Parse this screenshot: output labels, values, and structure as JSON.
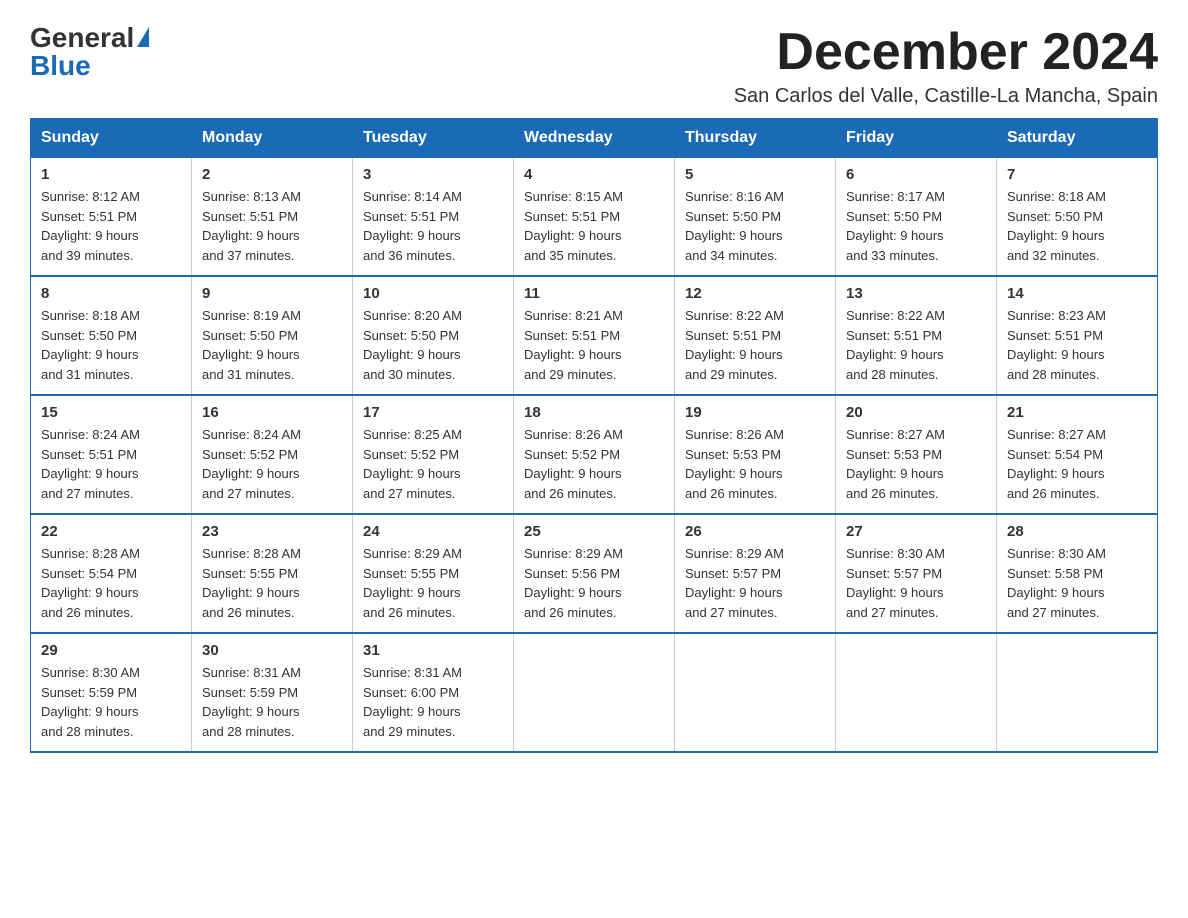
{
  "logo": {
    "general": "General",
    "blue": "Blue"
  },
  "header": {
    "month": "December 2024",
    "location": "San Carlos del Valle, Castille-La Mancha, Spain"
  },
  "weekdays": [
    "Sunday",
    "Monday",
    "Tuesday",
    "Wednesday",
    "Thursday",
    "Friday",
    "Saturday"
  ],
  "weeks": [
    [
      {
        "day": "1",
        "sunrise": "8:12 AM",
        "sunset": "5:51 PM",
        "daylight": "9 hours and 39 minutes."
      },
      {
        "day": "2",
        "sunrise": "8:13 AM",
        "sunset": "5:51 PM",
        "daylight": "9 hours and 37 minutes."
      },
      {
        "day": "3",
        "sunrise": "8:14 AM",
        "sunset": "5:51 PM",
        "daylight": "9 hours and 36 minutes."
      },
      {
        "day": "4",
        "sunrise": "8:15 AM",
        "sunset": "5:51 PM",
        "daylight": "9 hours and 35 minutes."
      },
      {
        "day": "5",
        "sunrise": "8:16 AM",
        "sunset": "5:50 PM",
        "daylight": "9 hours and 34 minutes."
      },
      {
        "day": "6",
        "sunrise": "8:17 AM",
        "sunset": "5:50 PM",
        "daylight": "9 hours and 33 minutes."
      },
      {
        "day": "7",
        "sunrise": "8:18 AM",
        "sunset": "5:50 PM",
        "daylight": "9 hours and 32 minutes."
      }
    ],
    [
      {
        "day": "8",
        "sunrise": "8:18 AM",
        "sunset": "5:50 PM",
        "daylight": "9 hours and 31 minutes."
      },
      {
        "day": "9",
        "sunrise": "8:19 AM",
        "sunset": "5:50 PM",
        "daylight": "9 hours and 31 minutes."
      },
      {
        "day": "10",
        "sunrise": "8:20 AM",
        "sunset": "5:50 PM",
        "daylight": "9 hours and 30 minutes."
      },
      {
        "day": "11",
        "sunrise": "8:21 AM",
        "sunset": "5:51 PM",
        "daylight": "9 hours and 29 minutes."
      },
      {
        "day": "12",
        "sunrise": "8:22 AM",
        "sunset": "5:51 PM",
        "daylight": "9 hours and 29 minutes."
      },
      {
        "day": "13",
        "sunrise": "8:22 AM",
        "sunset": "5:51 PM",
        "daylight": "9 hours and 28 minutes."
      },
      {
        "day": "14",
        "sunrise": "8:23 AM",
        "sunset": "5:51 PM",
        "daylight": "9 hours and 28 minutes."
      }
    ],
    [
      {
        "day": "15",
        "sunrise": "8:24 AM",
        "sunset": "5:51 PM",
        "daylight": "9 hours and 27 minutes."
      },
      {
        "day": "16",
        "sunrise": "8:24 AM",
        "sunset": "5:52 PM",
        "daylight": "9 hours and 27 minutes."
      },
      {
        "day": "17",
        "sunrise": "8:25 AM",
        "sunset": "5:52 PM",
        "daylight": "9 hours and 27 minutes."
      },
      {
        "day": "18",
        "sunrise": "8:26 AM",
        "sunset": "5:52 PM",
        "daylight": "9 hours and 26 minutes."
      },
      {
        "day": "19",
        "sunrise": "8:26 AM",
        "sunset": "5:53 PM",
        "daylight": "9 hours and 26 minutes."
      },
      {
        "day": "20",
        "sunrise": "8:27 AM",
        "sunset": "5:53 PM",
        "daylight": "9 hours and 26 minutes."
      },
      {
        "day": "21",
        "sunrise": "8:27 AM",
        "sunset": "5:54 PM",
        "daylight": "9 hours and 26 minutes."
      }
    ],
    [
      {
        "day": "22",
        "sunrise": "8:28 AM",
        "sunset": "5:54 PM",
        "daylight": "9 hours and 26 minutes."
      },
      {
        "day": "23",
        "sunrise": "8:28 AM",
        "sunset": "5:55 PM",
        "daylight": "9 hours and 26 minutes."
      },
      {
        "day": "24",
        "sunrise": "8:29 AM",
        "sunset": "5:55 PM",
        "daylight": "9 hours and 26 minutes."
      },
      {
        "day": "25",
        "sunrise": "8:29 AM",
        "sunset": "5:56 PM",
        "daylight": "9 hours and 26 minutes."
      },
      {
        "day": "26",
        "sunrise": "8:29 AM",
        "sunset": "5:57 PM",
        "daylight": "9 hours and 27 minutes."
      },
      {
        "day": "27",
        "sunrise": "8:30 AM",
        "sunset": "5:57 PM",
        "daylight": "9 hours and 27 minutes."
      },
      {
        "day": "28",
        "sunrise": "8:30 AM",
        "sunset": "5:58 PM",
        "daylight": "9 hours and 27 minutes."
      }
    ],
    [
      {
        "day": "29",
        "sunrise": "8:30 AM",
        "sunset": "5:59 PM",
        "daylight": "9 hours and 28 minutes."
      },
      {
        "day": "30",
        "sunrise": "8:31 AM",
        "sunset": "5:59 PM",
        "daylight": "9 hours and 28 minutes."
      },
      {
        "day": "31",
        "sunrise": "8:31 AM",
        "sunset": "6:00 PM",
        "daylight": "9 hours and 29 minutes."
      },
      null,
      null,
      null,
      null
    ]
  ],
  "labels": {
    "sunrise": "Sunrise:",
    "sunset": "Sunset:",
    "daylight": "Daylight:"
  }
}
